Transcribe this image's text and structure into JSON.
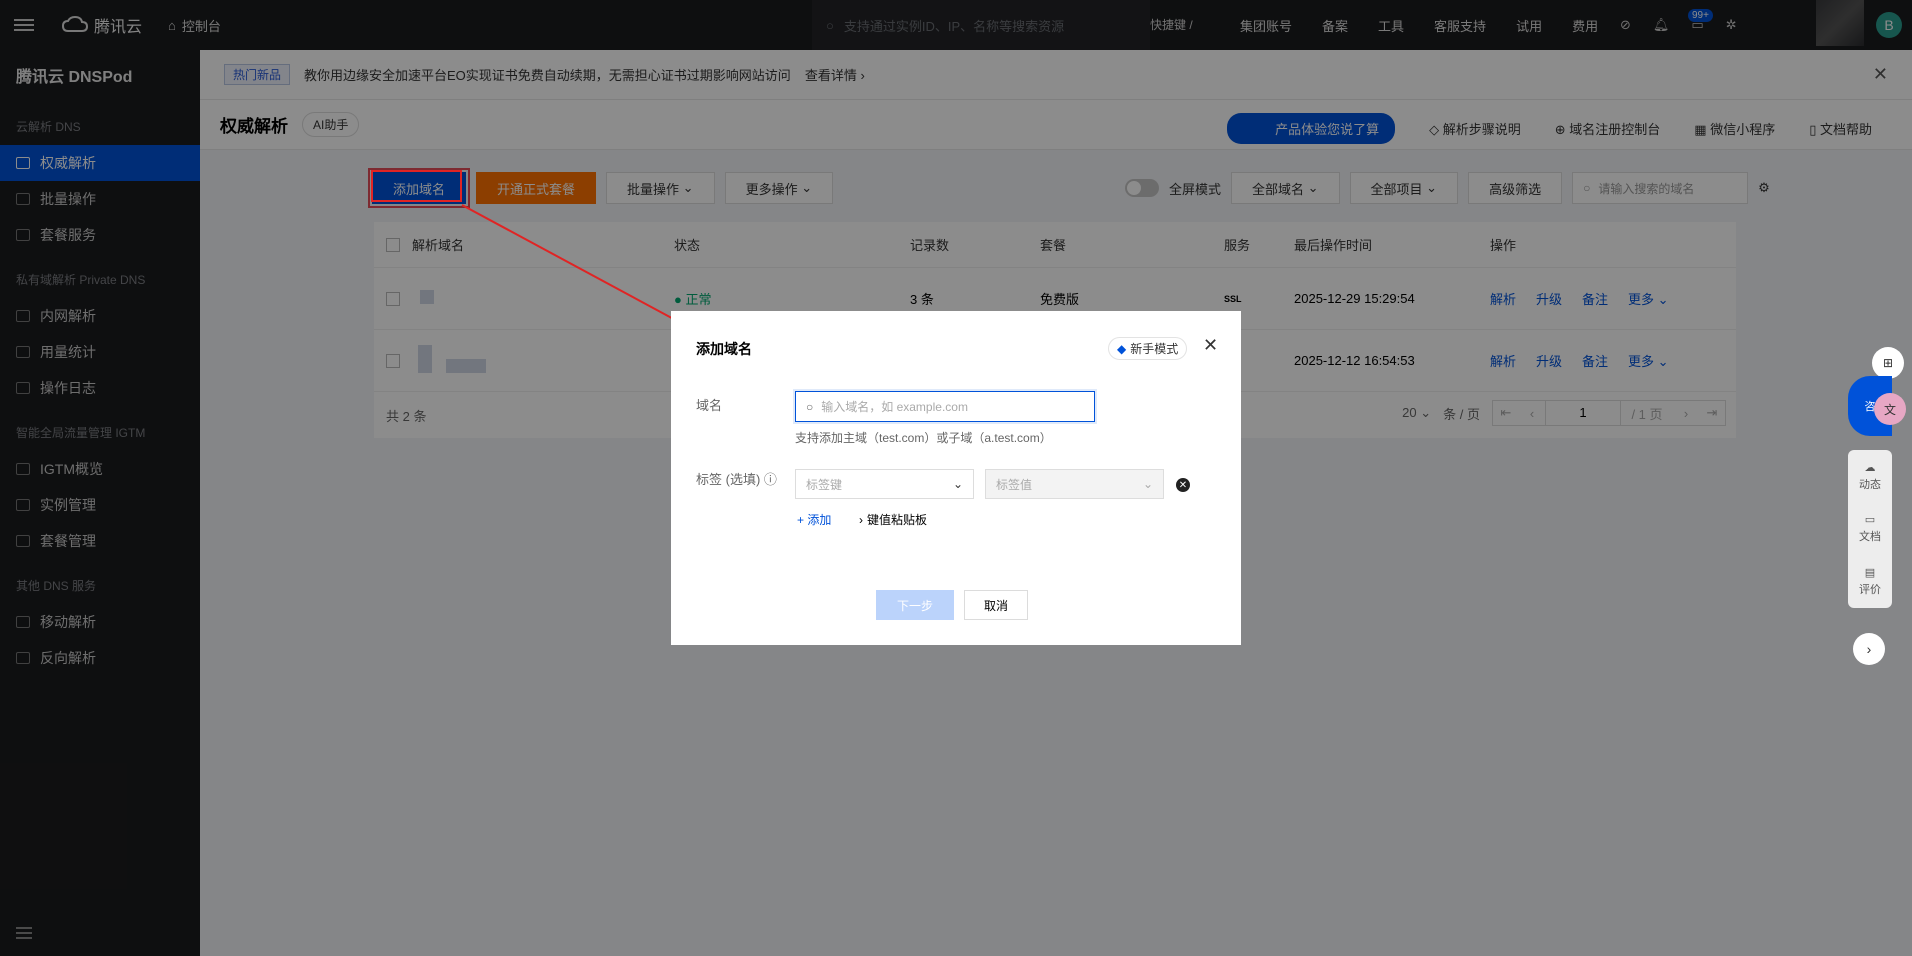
{
  "topbar": {
    "brand": "腾讯云",
    "console": "控制台",
    "search_placeholder": "支持通过实例ID、IP、名称等搜索资源",
    "hotkey": "快捷键 /",
    "links": [
      "集团账号",
      "备案",
      "工具",
      "客服支持",
      "试用",
      "费用"
    ],
    "notification_badge": "99+",
    "avatar_letter": "B"
  },
  "sidebar": {
    "title": "腾讯云 DNSPod",
    "groups": [
      {
        "label": "云解析 DNS",
        "items": [
          "权威解析",
          "批量操作",
          "套餐服务"
        ]
      },
      {
        "label": "私有域解析 Private DNS",
        "items": [
          "内网解析",
          "用量统计",
          "操作日志"
        ]
      },
      {
        "label": "智能全局流量管理 IGTM",
        "items": [
          "IGTM概览",
          "实例管理",
          "套餐管理"
        ]
      },
      {
        "label": "其他 DNS 服务",
        "items": [
          "移动解析",
          "反向解析"
        ]
      }
    ],
    "active_item": "权威解析"
  },
  "notice": {
    "tag": "热门新品",
    "text": "教你用边缘安全加速平台EO实现证书免费自动续期，无需担心证书过期影响网站访问",
    "more": "查看详情"
  },
  "pagehead": {
    "title": "权威解析",
    "ai_button": "AI助手",
    "links": [
      "产品体验您说了算",
      "解析步骤说明",
      "域名注册控制台",
      "微信小程序",
      "文档帮助"
    ]
  },
  "toolbar": {
    "add_domain": "添加域名",
    "open_package": "开通正式套餐",
    "batch": "批量操作",
    "more_ops": "更多操作",
    "fullscreen": "全屏模式",
    "all_domains": "全部域名",
    "all_projects": "全部项目",
    "advanced_filter": "高级筛选",
    "search_placeholder": "请输入搜索的域名"
  },
  "table": {
    "headers": [
      "解析域名",
      "状态",
      "记录数",
      "套餐",
      "服务",
      "最后操作时间",
      "操作"
    ],
    "rows": [
      {
        "status": "正常",
        "records": "3 条",
        "package": "免费版",
        "service": "SSL",
        "time": "2025-12-29 15:29:54",
        "actions": [
          "解析",
          "升级",
          "备注",
          "更多"
        ]
      },
      {
        "status": "",
        "records": "",
        "package": "",
        "service": "",
        "time": "2025-12-12 16:54:53",
        "actions": [
          "解析",
          "升级",
          "备注",
          "更多"
        ]
      }
    ],
    "total": "共 2 条",
    "page_size": "20",
    "per_page": "条 / 页",
    "page": "1",
    "page_total": "/ 1 页"
  },
  "dialog": {
    "title": "添加域名",
    "novice_mode": "新手模式",
    "domain_label": "域名",
    "domain_placeholder": "输入域名，如 example.com",
    "hint": "支持添加主域（test.com）或子域（a.test.com）",
    "tag_label": "标签 (选填)",
    "tag_key_placeholder": "标签键",
    "tag_value_placeholder": "标签值",
    "add": "添加",
    "paste": "键值粘贴板",
    "next": "下一步",
    "cancel": "取消"
  },
  "float": {
    "consult": "咨",
    "items": [
      "动态",
      "文档",
      "评价"
    ]
  }
}
